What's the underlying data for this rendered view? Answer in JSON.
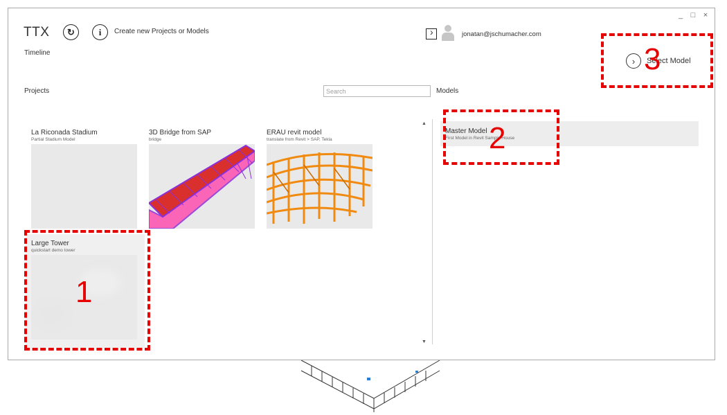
{
  "app": {
    "title": "TTX",
    "create_link": "Create new Projects or Models",
    "timeline_link": "Timeline"
  },
  "window_controls": {
    "minimize": "_",
    "maximize": "□",
    "close": "×"
  },
  "user": {
    "email": "jonatan@jschumacher.com"
  },
  "toolbar": {
    "select_model_label": "Select Model"
  },
  "projects": {
    "label": "Projects",
    "search_placeholder": "Search",
    "items": [
      {
        "title": "La Riconada Stadium",
        "subtitle": "Partial Stadium Model"
      },
      {
        "title": "3D Bridge from SAP",
        "subtitle": "bridge"
      },
      {
        "title": "ERAU revit model",
        "subtitle": "translate from Revit > SAP, Tekla"
      },
      {
        "title": "Large Tower",
        "subtitle": "quickstart demo tower"
      }
    ]
  },
  "models": {
    "label": "Models",
    "items": [
      {
        "title": "Master Model",
        "subtitle": "First Model in Revit Sample House"
      }
    ]
  },
  "annotations": {
    "one": "1",
    "two": "2",
    "three": "3"
  },
  "colors": {
    "annotation_red": "#e60000",
    "bridge_red": "#d9302d",
    "bridge_purple": "#8b2fd9",
    "truss_orange": "#f08a10"
  }
}
